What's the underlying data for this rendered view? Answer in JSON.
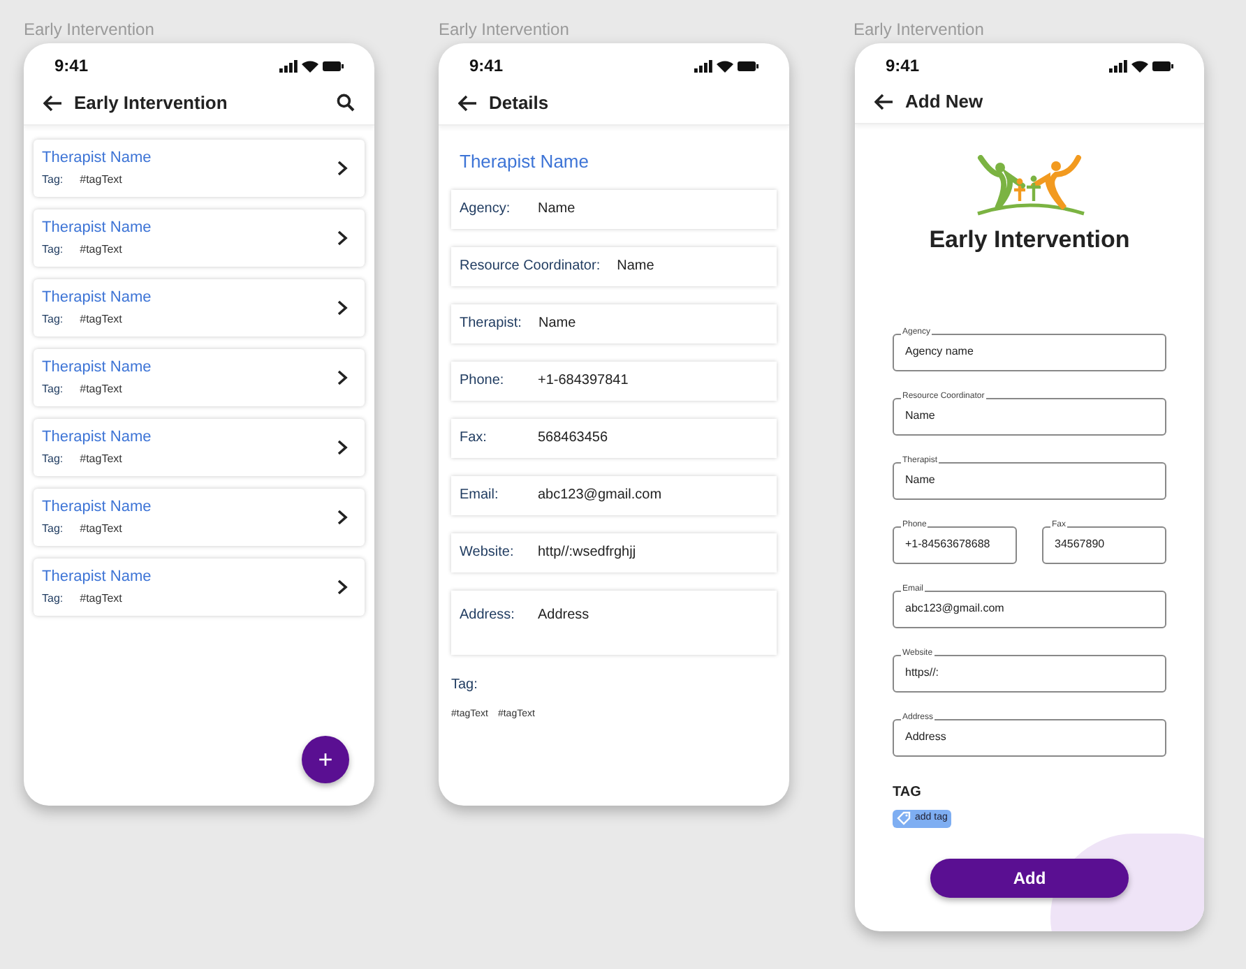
{
  "list_screen": {
    "caption": "Early Intervention",
    "status_time": "9:41",
    "title": "Early Intervention",
    "items": [
      {
        "name": "Therapist Name",
        "tag_label": "Tag:",
        "tag": "#tagText"
      },
      {
        "name": "Therapist Name",
        "tag_label": "Tag:",
        "tag": "#tagText"
      },
      {
        "name": "Therapist Name",
        "tag_label": "Tag:",
        "tag": "#tagText"
      },
      {
        "name": "Therapist Name",
        "tag_label": "Tag:",
        "tag": "#tagText"
      },
      {
        "name": "Therapist Name",
        "tag_label": "Tag:",
        "tag": "#tagText"
      },
      {
        "name": "Therapist Name",
        "tag_label": "Tag:",
        "tag": "#tagText"
      },
      {
        "name": "Therapist Name",
        "tag_label": "Tag:",
        "tag": "#tagText"
      }
    ],
    "fab": "+"
  },
  "details_screen": {
    "caption": "Early Intervention",
    "status_time": "9:41",
    "title": "Details",
    "heading": "Therapist Name",
    "rows": [
      {
        "label": "Agency:",
        "value": "Name"
      },
      {
        "label": "Resource Coordinator:",
        "value": "Name"
      },
      {
        "label": "Therapist:",
        "value": "Name"
      },
      {
        "label": "Phone:",
        "value": "+1-684397841"
      },
      {
        "label": "Fax:",
        "value": "568463456"
      },
      {
        "label": "Email:",
        "value": "abc123@gmail.com"
      },
      {
        "label": "Website:",
        "value": "http//:wsedfrghjj"
      },
      {
        "label": "Address:",
        "value": "Address",
        "kind": "tall"
      }
    ],
    "tag_label": "Tag:",
    "tags": [
      "#tagText",
      "#tagText"
    ]
  },
  "add_screen": {
    "caption": "Early Intervention",
    "status_time": "9:41",
    "title": "Add New",
    "logo_text": "Early Intervention",
    "fields": [
      [
        {
          "label": "Agency",
          "value": "Agency name"
        }
      ],
      [
        {
          "label": "Resource Coordinator",
          "value": "Name"
        }
      ],
      [
        {
          "label": "Therapist",
          "value": "Name"
        }
      ],
      [
        {
          "label": "Phone",
          "value": "+1-84563678688"
        },
        {
          "label": "Fax",
          "value": "34567890"
        }
      ],
      [
        {
          "label": "Email",
          "value": "abc123@gmail.com"
        }
      ],
      [
        {
          "label": "Website",
          "value": "https//:"
        }
      ],
      [
        {
          "label": "Address",
          "value": "Address"
        }
      ]
    ],
    "tag_heading": "TAG",
    "add_tag": "add tag",
    "submit": "Add"
  }
}
